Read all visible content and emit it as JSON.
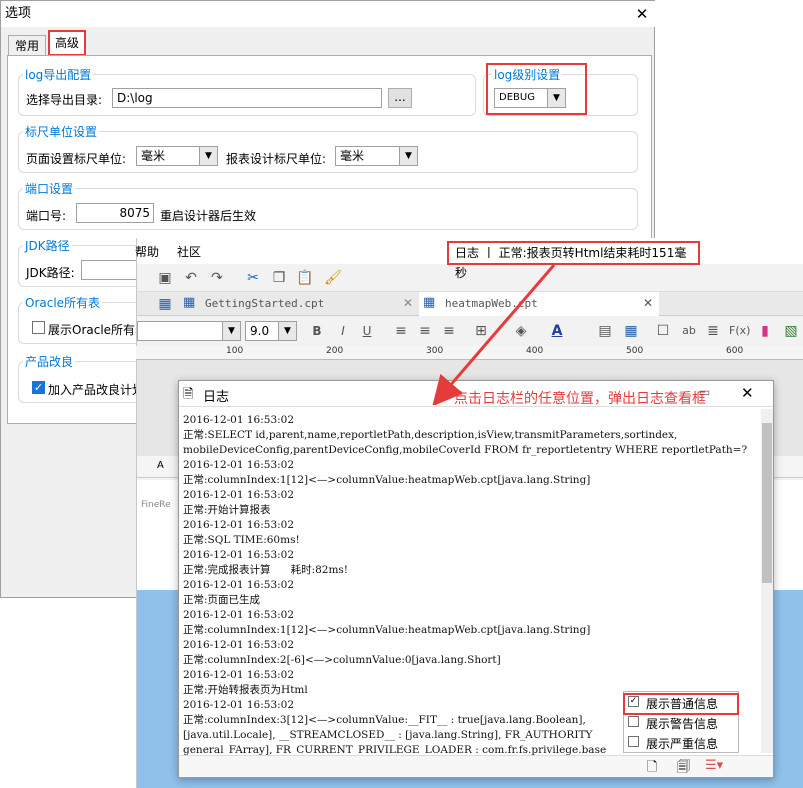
{
  "options_dialog": {
    "title": "选项",
    "tabs": [
      {
        "label": "常用"
      },
      {
        "label": "高级"
      }
    ],
    "log_export": {
      "group_title": "log导出配置",
      "dir_label": "选择导出目录:",
      "dir_value": "D:\\log",
      "browse_label": "..."
    },
    "log_level": {
      "group_title": "log级别设置",
      "value": "DEBUG"
    },
    "ruler_unit": {
      "group_title": "标尺单位设置",
      "page_label": "页面设置标尺单位:",
      "page_value": "毫米",
      "report_label": "报表设计标尺单位:",
      "report_value": "毫米"
    },
    "port": {
      "group_title": "端口设置",
      "label": "端口号:",
      "value": "8075",
      "note": "重启设计器后生效"
    },
    "jdk": {
      "group_title": "JDK路径",
      "label": "JDK路径:"
    },
    "oracle": {
      "group_title": "Oracle所有表",
      "checkbox_label": "展示Oracle所有表"
    },
    "improve": {
      "group_title": "产品改良",
      "checkbox_label": "加入产品改良计划"
    }
  },
  "designer": {
    "menu": [
      "帮助",
      "社区"
    ],
    "status_bar_text": "日志 丨 正常:报表页转Html结束耗时151毫秒",
    "file_tabs": [
      {
        "label": "GettingStarted.cpt"
      },
      {
        "label": "heatmapWeb.cpt"
      }
    ],
    "font_size": "9.0",
    "ruler_ticks": [
      "100",
      "200",
      "300",
      "400",
      "500",
      "600"
    ],
    "cell_header": "A"
  },
  "log_window": {
    "title": "日志",
    "lines": [
      "2016-12-01 16:53:02",
      "正常:SELECT id,parent,name,reportletPath,description,isView,transmitParameters,sortindex,",
      "mobileDeviceConfig,parentDeviceConfig,mobileCoverId FROM fr_reportletentry WHERE reportletPath=?",
      "2016-12-01 16:53:02",
      "正常:columnIndex:1[12]<—>columnValue:heatmapWeb.cpt[java.lang.String]",
      "2016-12-01 16:53:02",
      "正常:开始计算报表",
      "2016-12-01 16:53:02",
      "正常:SQL TIME:60ms!",
      "2016-12-01 16:53:02",
      "正常:完成报表计算      耗时:82ms!",
      "2016-12-01 16:53:02",
      "正常:页面已生成",
      "2016-12-01 16:53:02",
      "正常:columnIndex:1[12]<—>columnValue:heatmapWeb.cpt[java.lang.String]",
      "2016-12-01 16:53:02",
      "正常:columnIndex:2[-6]<—>columnValue:0[java.lang.Short]",
      "2016-12-01 16:53:02",
      "正常:开始转报表页为Html",
      "2016-12-01 16:53:02",
      "正常:columnIndex:3[12]<—>columnValue:__FIT__ : true[java.lang.Boolean],",
      "[java.util.Locale], __STREAMCLOSED__ : [java.lang.String], FR_AUTHORITY",
      "general_FArray], FR_CURRENT_PRIVILEGE_LOADER : com.fr.fs.privilege.base"
    ],
    "filters": [
      {
        "label": "展示普通信息",
        "checked": true
      },
      {
        "label": "展示警告信息",
        "checked": false
      },
      {
        "label": "展示严重信息",
        "checked": false
      }
    ]
  },
  "annotation": "点击日志栏的任意位置，弹出日志查看框"
}
